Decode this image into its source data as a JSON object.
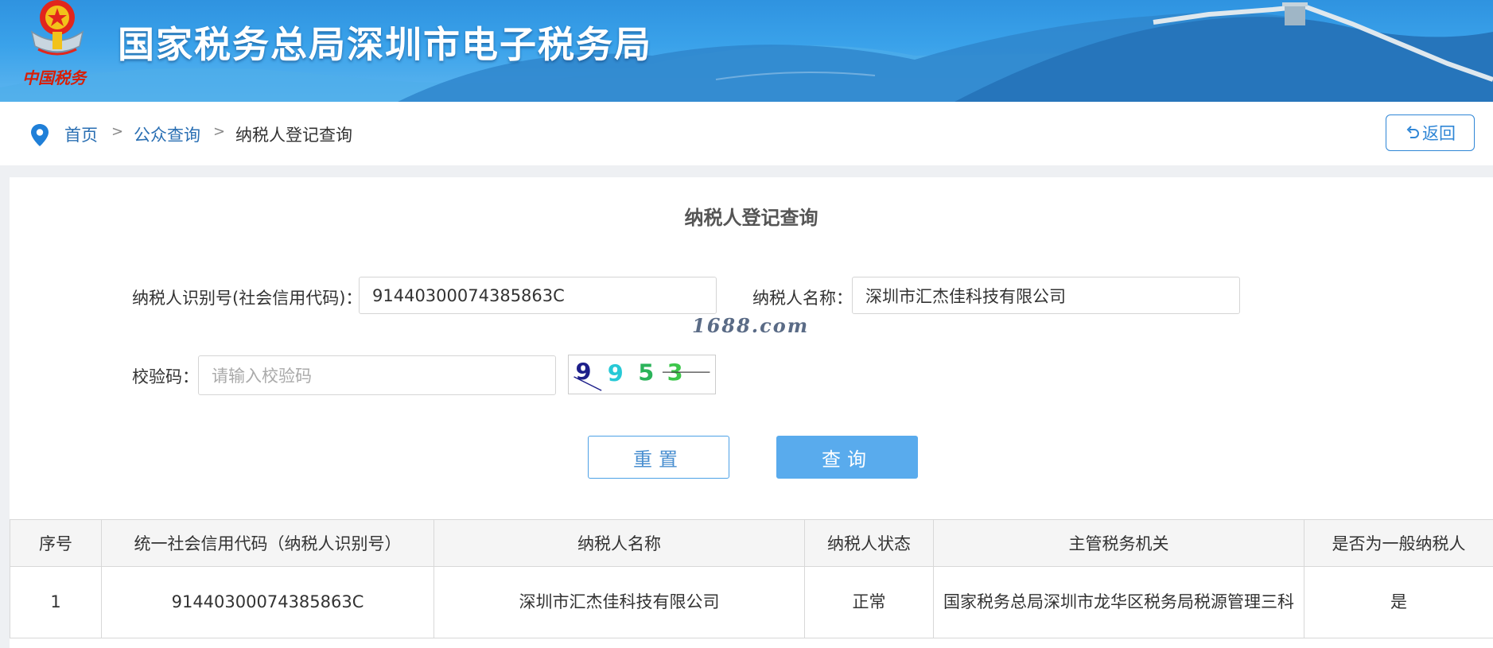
{
  "header": {
    "site_title": "国家税务总局深圳市电子税务局",
    "emblem_caption": "中国税务"
  },
  "breadcrumb": {
    "home": "首页",
    "separator": ">",
    "public_query": "公众查询",
    "current": "纳税人登记查询"
  },
  "back_button": {
    "label": "返回"
  },
  "form": {
    "title": "纳税人登记查询",
    "taxpayer_id_label": "纳税人识别号(社会信用代码)：",
    "taxpayer_id_value": "91440300074385863C",
    "taxpayer_name_label": "纳税人名称：",
    "taxpayer_name_value": "深圳市汇杰佳科技有限公司",
    "captcha_label": "校验码：",
    "captcha_placeholder": "请输入校验码",
    "captcha_code": "9953",
    "reset_label": "重置",
    "query_label": "查询"
  },
  "watermark": "1688.com",
  "table": {
    "headers": [
      "序号",
      "统一社会信用代码（纳税人识别号）",
      "纳税人名称",
      "纳税人状态",
      "主管税务机关",
      "是否为一般纳税人"
    ],
    "rows": [
      [
        "1",
        "91440300074385863C",
        "深圳市汇杰佳科技有限公司",
        "正常",
        "国家税务总局深圳市龙华区税务局税源管理三科",
        "是"
      ]
    ]
  },
  "colors": {
    "banner_blue": "#3aa2ea",
    "link_blue": "#2a6fb3",
    "query_button": "#59abed",
    "emblem_red": "#d81e06"
  }
}
